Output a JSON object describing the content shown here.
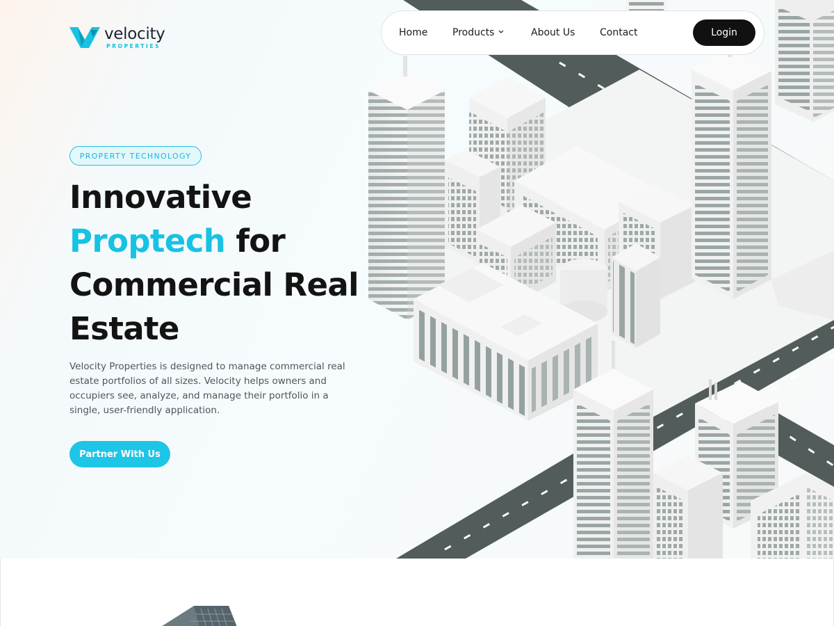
{
  "brand": {
    "name": "velocity",
    "sub": "PROPERTIES",
    "accent_color": "#17c2e3",
    "logo_icon": "velocity-v-logo-icon"
  },
  "nav": {
    "items": [
      {
        "label": "Home"
      },
      {
        "label": "Products",
        "icon": "chevron-down-icon"
      },
      {
        "label": "About Us"
      },
      {
        "label": "Contact"
      }
    ],
    "login_label": "Login"
  },
  "hero": {
    "tag": "PROPERTY TECHNOLOGY",
    "headline": {
      "line1": "Innovative",
      "accent": "Proptech",
      "line2_rest": " for",
      "line3": "Commercial Real",
      "line4": "Estate"
    },
    "description": "Velocity Properties is designed to manage commercial real estate portfolios of all sizes. Velocity helps owners and occupiers see, analyze, and manage their portfolio in a single, user-friendly application.",
    "cta_label": "Partner With Us",
    "illustration": "isometric-city-illustration"
  },
  "colors": {
    "cta": "#1dc5e6",
    "login_bg": "#111111",
    "road": "#505a5a"
  }
}
